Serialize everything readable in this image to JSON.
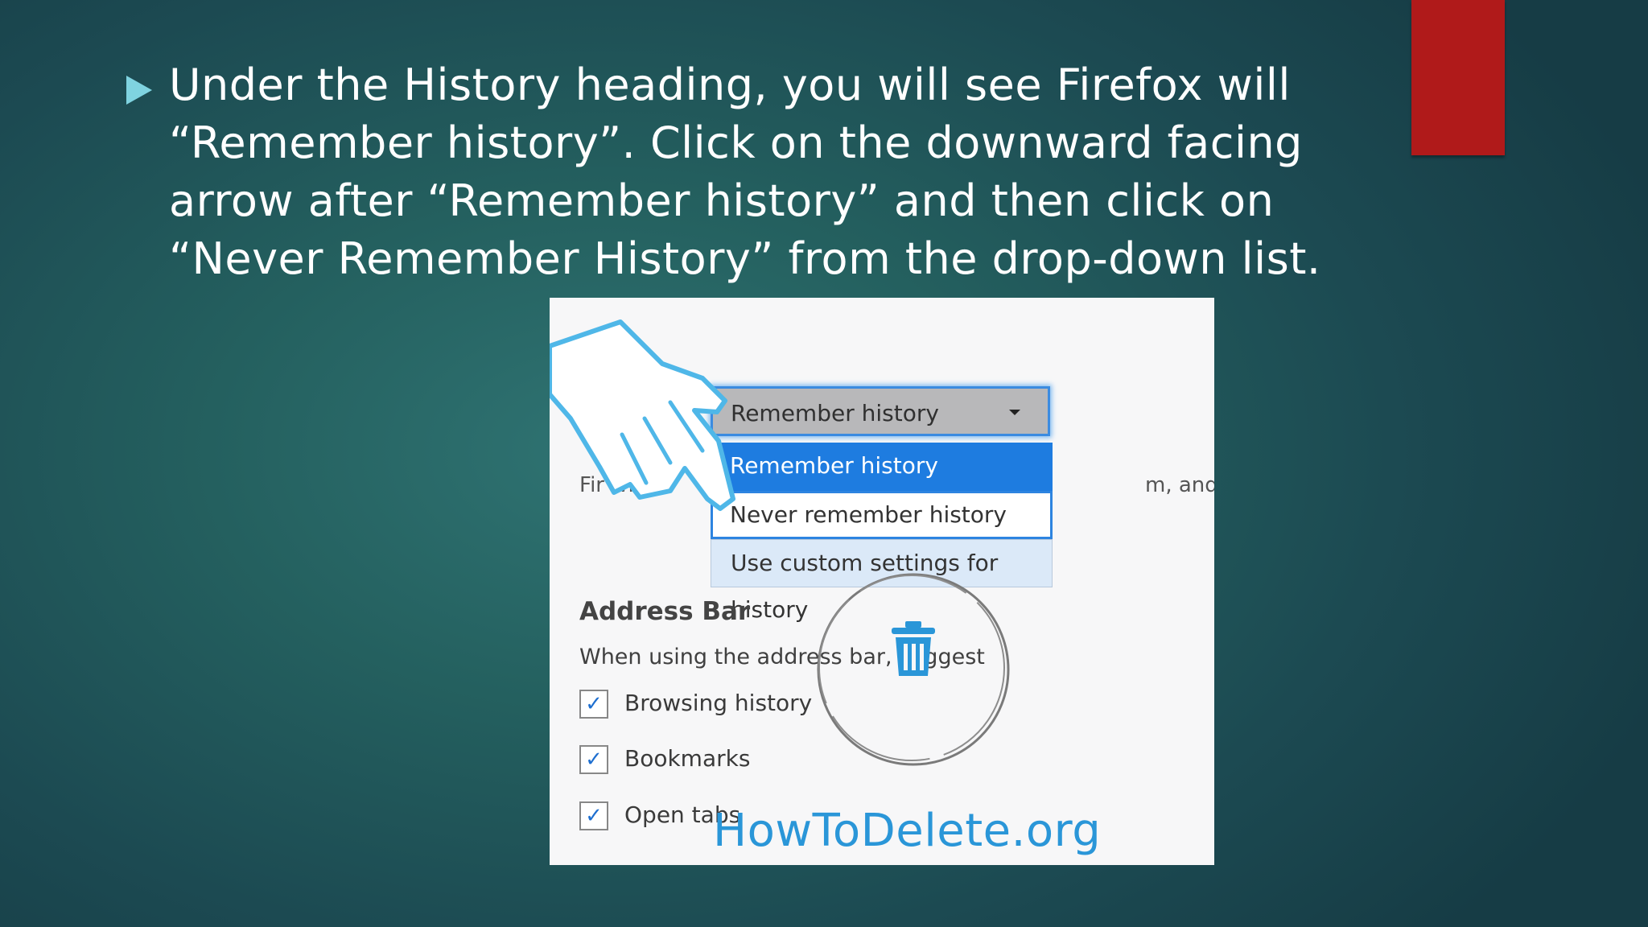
{
  "slide": {
    "bullet_text": "Under the History heading, you will see Firefox will “Remember history”. Click on the downward facing arrow after “Remember history” and then click on “Never Remember History” from the drop-down list.",
    "accent_color": "#b01a1a",
    "bullet_color": "#7fd3e0"
  },
  "screenshot": {
    "dropdown": {
      "selected": "Remember history",
      "options": [
        "Remember history",
        "Never remember history",
        "Use custom settings for history"
      ]
    },
    "partial_left_text": "Fir     will",
    "partial_right_text": "m, and",
    "address_bar": {
      "title": "Address Bar",
      "description": "When using the address bar, suggest",
      "checkboxes": [
        {
          "label": "Browsing history",
          "checked": true
        },
        {
          "label": "Bookmarks",
          "checked": true
        },
        {
          "label": "Open tabs",
          "checked": true
        }
      ]
    },
    "watermark": "HowToDelete.org",
    "icons": {
      "hand": "pointing-hand-icon",
      "trash": "trash-can-icon"
    }
  }
}
